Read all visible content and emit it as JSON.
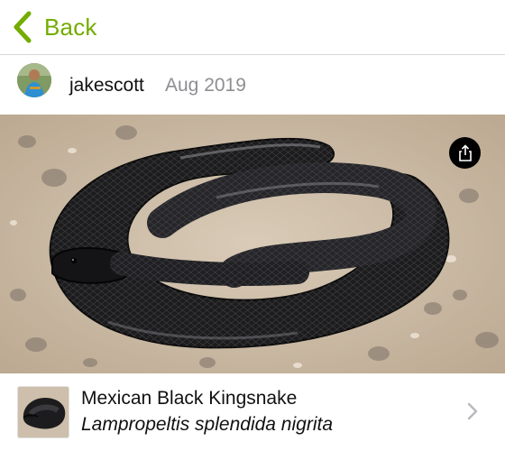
{
  "nav": {
    "back_label": "Back",
    "back_icon": "chevron-left-icon",
    "accent_color": "#74ac00"
  },
  "observer": {
    "username": "jakescott",
    "date": "Aug 2019"
  },
  "photo": {
    "share_icon": "share-icon"
  },
  "taxon": {
    "common_name": "Mexican Black Kingsnake",
    "scientific_name": "Lampropeltis splendida nigrita",
    "chevron_icon": "chevron-right-icon"
  }
}
